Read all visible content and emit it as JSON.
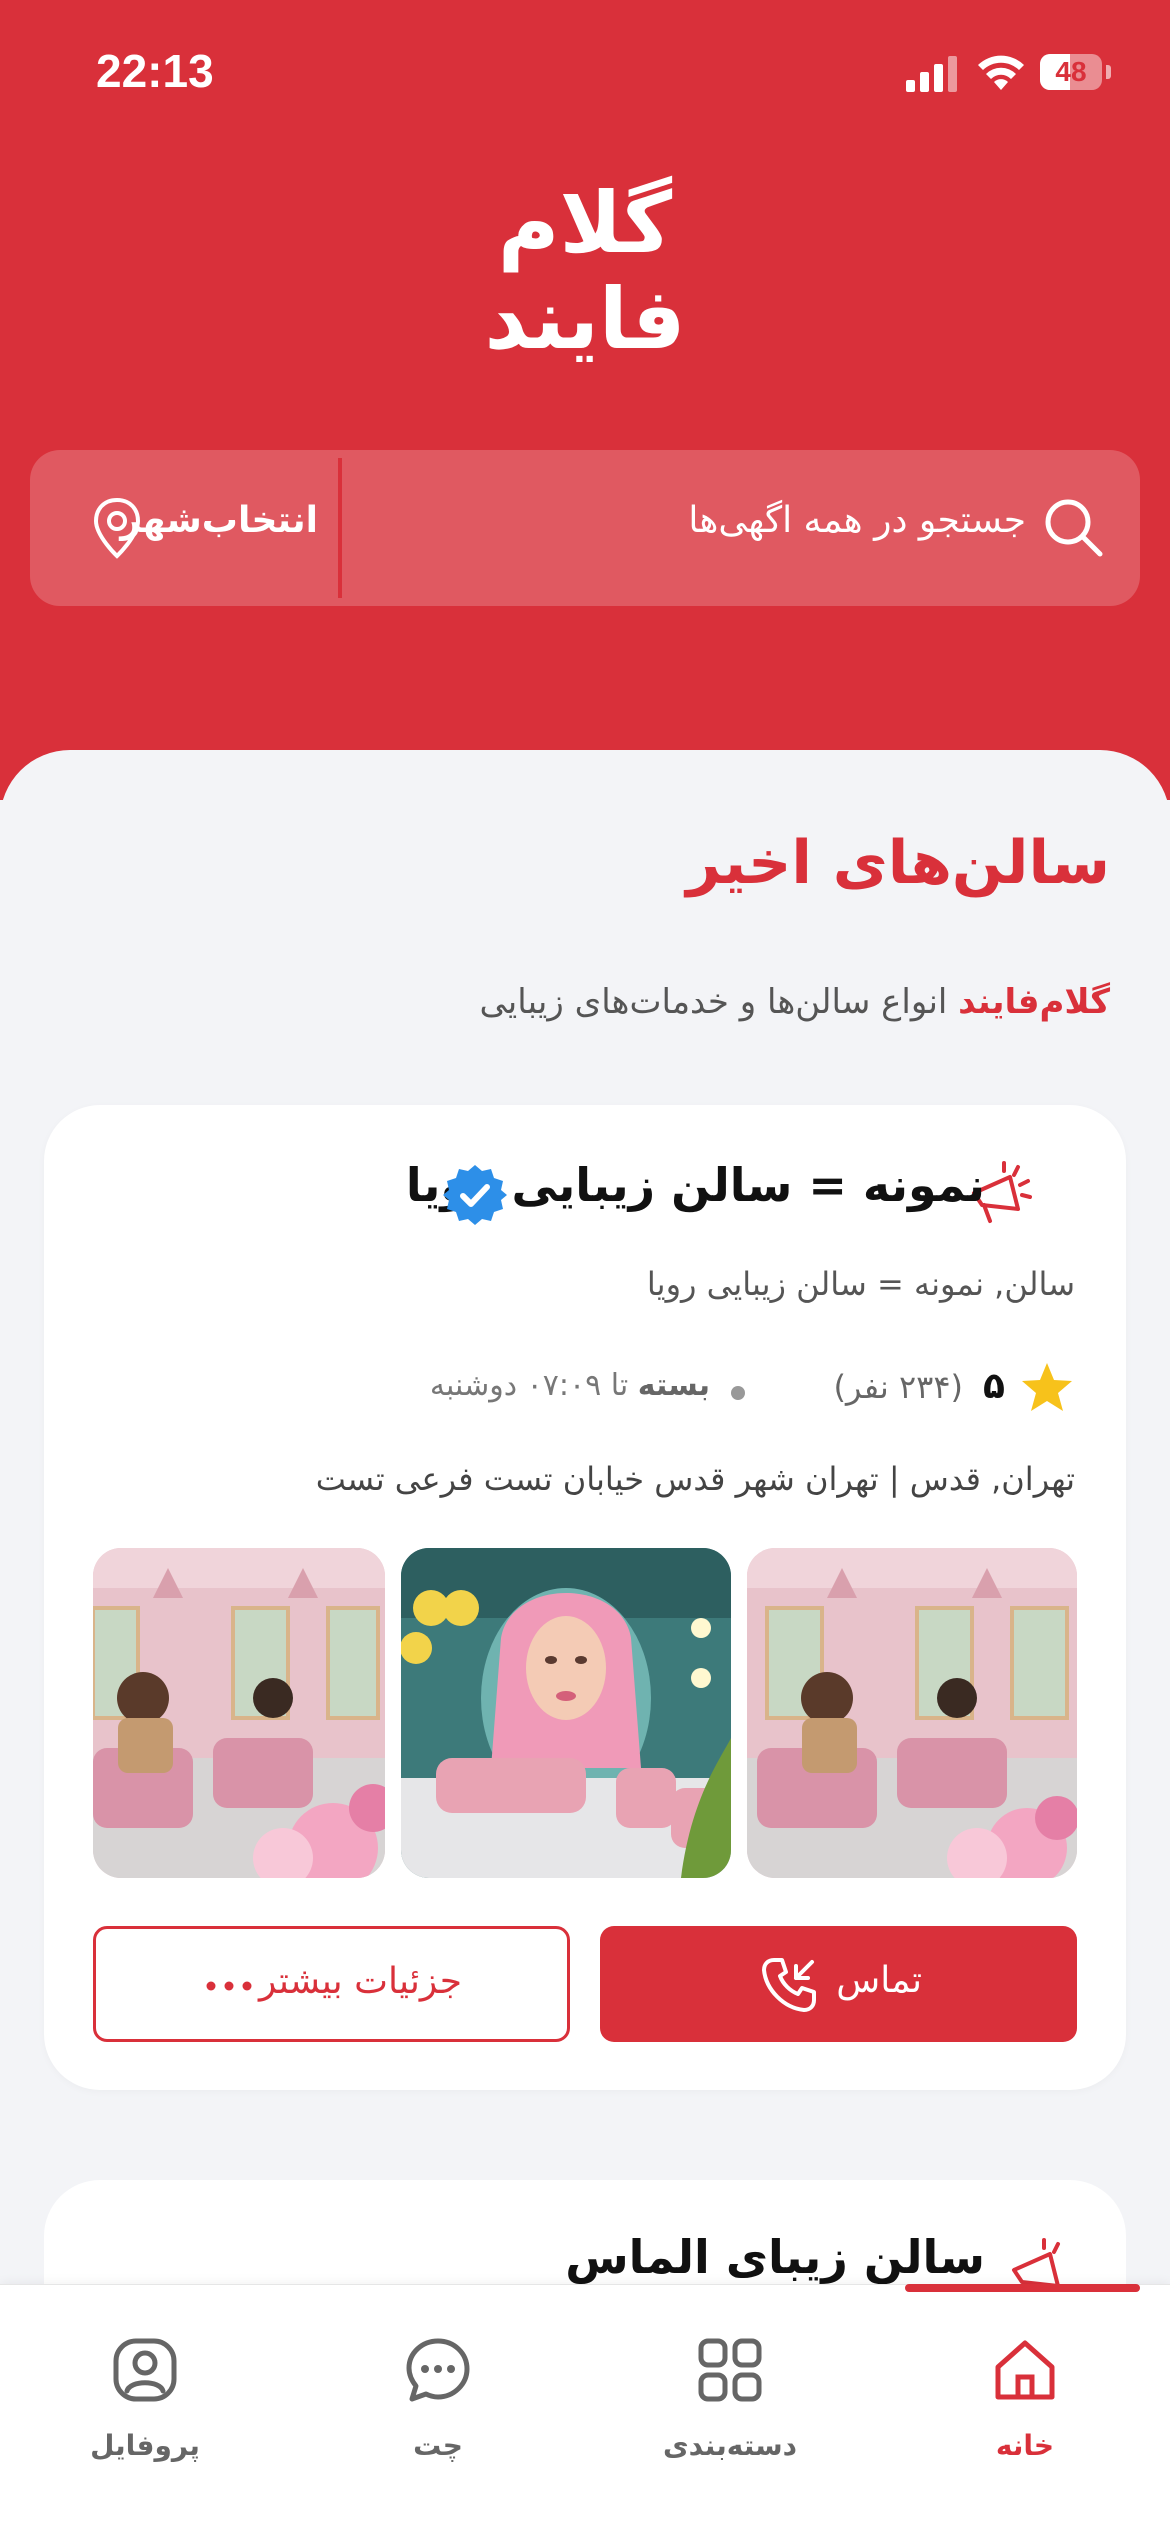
{
  "status_bar": {
    "time": "22:13",
    "battery": "48",
    "battery_fraction": 0.48
  },
  "brand": {
    "logo_line1": "گلام",
    "logo_line2": "فایند",
    "primary_color": "#d9303a"
  },
  "search": {
    "placeholder": "جستجو در همه اگهی‌ها",
    "city_label": "انتخاب‌شهر"
  },
  "section": {
    "title": "سالن‌های اخیر",
    "subtitle_brand": "گلام‌فایند",
    "subtitle_rest": "انواع سالن‌ها و خدمات‌های زیبایی"
  },
  "listing": {
    "title": "نمونه = سالن زیبایی رویا",
    "subtitle": "سالن, نمونه = سالن زیبایی رویا",
    "rating": "۵",
    "rating_count": "(۲۳۴ نفر)",
    "status": "بسته",
    "hours_text": "تا ۰۷:۰۹ دوشنبه",
    "address": "تهران, قدس | تهران شهر قدس خیابان تست فرعی تست",
    "call_label": "تماس",
    "more_label": "جزئیات بیشتر"
  },
  "next_listing": {
    "title": "سالن زیبای الماس"
  },
  "tabs": [
    {
      "label": "خانه",
      "icon": "home-icon",
      "active": true
    },
    {
      "label": "دسته‌بندی",
      "icon": "grid-icon",
      "active": false
    },
    {
      "label": "چت",
      "icon": "chat-icon",
      "active": false
    },
    {
      "label": "پروفایل",
      "icon": "profile-icon",
      "active": false
    }
  ]
}
